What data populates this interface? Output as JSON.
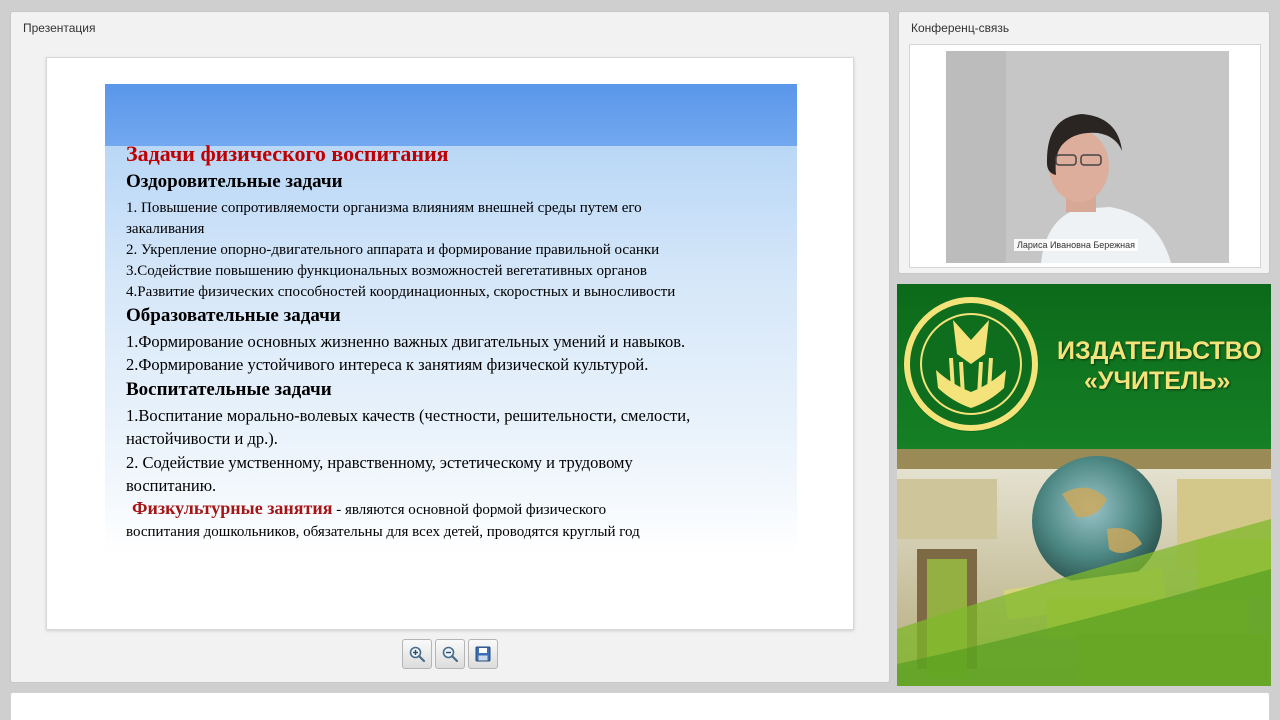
{
  "presentation": {
    "title": "Презентация",
    "slide": {
      "title": "Задачи физического воспитания",
      "section1": {
        "heading": "Оздоровительные задачи",
        "items": [
          "1. Повышение сопротивляемости организма влияниям внешней среды путем его",
          "закаливания",
          "2. Укрепление опорно-двигательного аппарата и формирование правильной осанки",
          "3.Содействие повышению функциональных возможностей  вегетативных органов",
          "4.Развитие физических способностей координационных, скоростных и выносливости"
        ]
      },
      "section2": {
        "heading": "Образовательные задачи",
        "items": [
          "1.Формирование основных жизненно важных двигательных умений и навыков.",
          "2.Формирование устойчивого интереса к занятиям физической культурой."
        ]
      },
      "section3": {
        "heading": "Воспитательные задачи",
        "items": [
          "1.Воспитание морально-волевых качеств (честности, решительности, смелости,",
          "настойчивости и др.).",
          "2. Содействие умственному, нравственному, эстетическому и трудовому",
          "воспитанию."
        ]
      },
      "footer_highlight": "Физкультурные занятия",
      "footer_text_1": " - являются основной формой физического",
      "footer_text_2": "воспитания дошкольников, обязательны для всех детей, проводятся  круглый год"
    },
    "toolbar": {
      "zoom_in_icon": "zoom-in-icon",
      "zoom_out_icon": "zoom-out-icon",
      "save_icon": "save-icon"
    }
  },
  "conference": {
    "title": "Конференц-связь",
    "participant_name": "Лариса Ивановна Бережная"
  },
  "banner": {
    "line1": "ИЗДАТЕЛЬСТВО",
    "line2": "«УЧИТЕЛЬ»",
    "colors": {
      "green": "#0f6e1d",
      "gold": "#f4e27a"
    }
  }
}
